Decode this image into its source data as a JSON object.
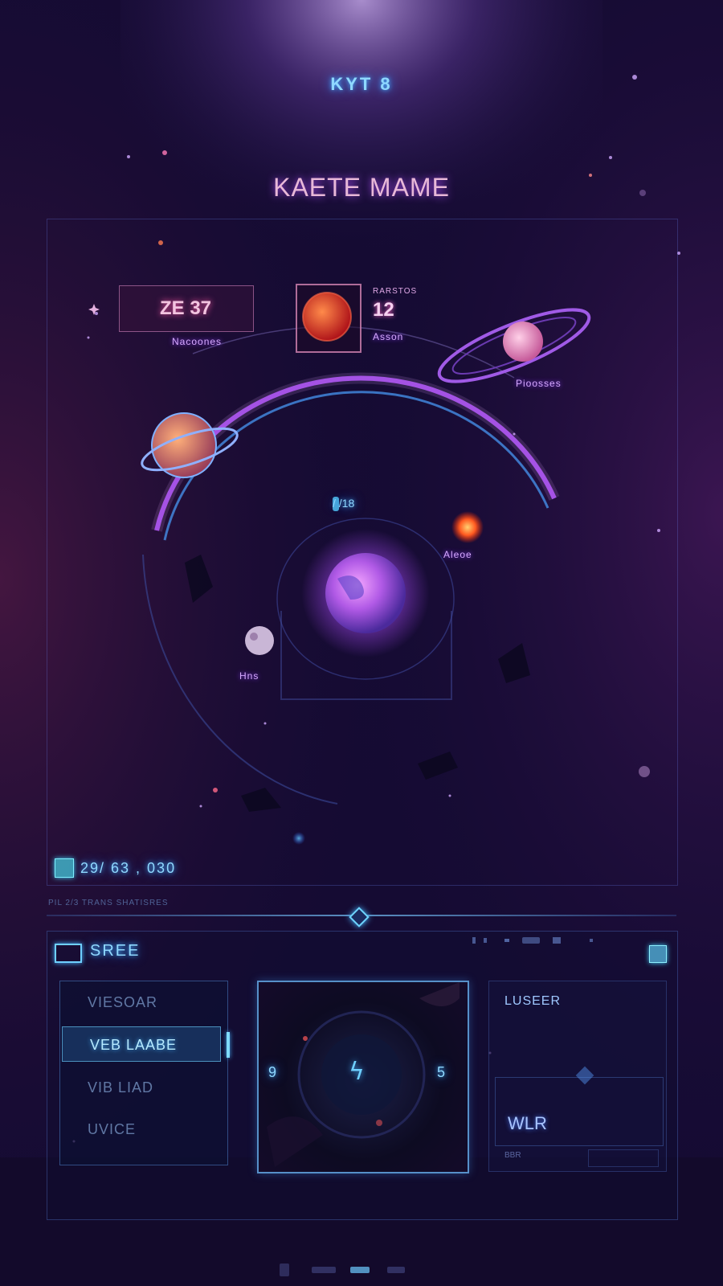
{
  "header": {
    "code": "KYT 8",
    "title": "KAETE MAME"
  },
  "map": {
    "resource": {
      "value": "ZE 37",
      "caption": "Nacoones"
    },
    "planet_card": {
      "mini": "RARSTOS",
      "value": "12",
      "caption": "Asson"
    },
    "labels": {
      "ringed_right": "Pioosses",
      "center": "/ /18",
      "fire": "Aleoe",
      "moon": "Hns"
    },
    "status": {
      "text": "29/ 63 , 030",
      "sub": "PIL 2/3 TRANS SHATISRES"
    }
  },
  "panel": {
    "title": "SREE",
    "menu": [
      {
        "label": "VIESOAR",
        "active": false
      },
      {
        "label": "VEB LAABE",
        "active": true
      },
      {
        "label": "VIB LIAD",
        "active": false
      },
      {
        "label": "UVICE",
        "active": false
      }
    ],
    "viewer": {
      "center_glyph": "ϟ",
      "left": "9",
      "right": "5"
    },
    "info": {
      "title": "LUSEER",
      "value": "WLR",
      "foot": "BBR"
    }
  },
  "colors": {
    "background": "#150b33",
    "accent_blue": "#6fd0ff",
    "accent_pink": "#ff5aa8",
    "planet_purple": "#b04dff"
  }
}
